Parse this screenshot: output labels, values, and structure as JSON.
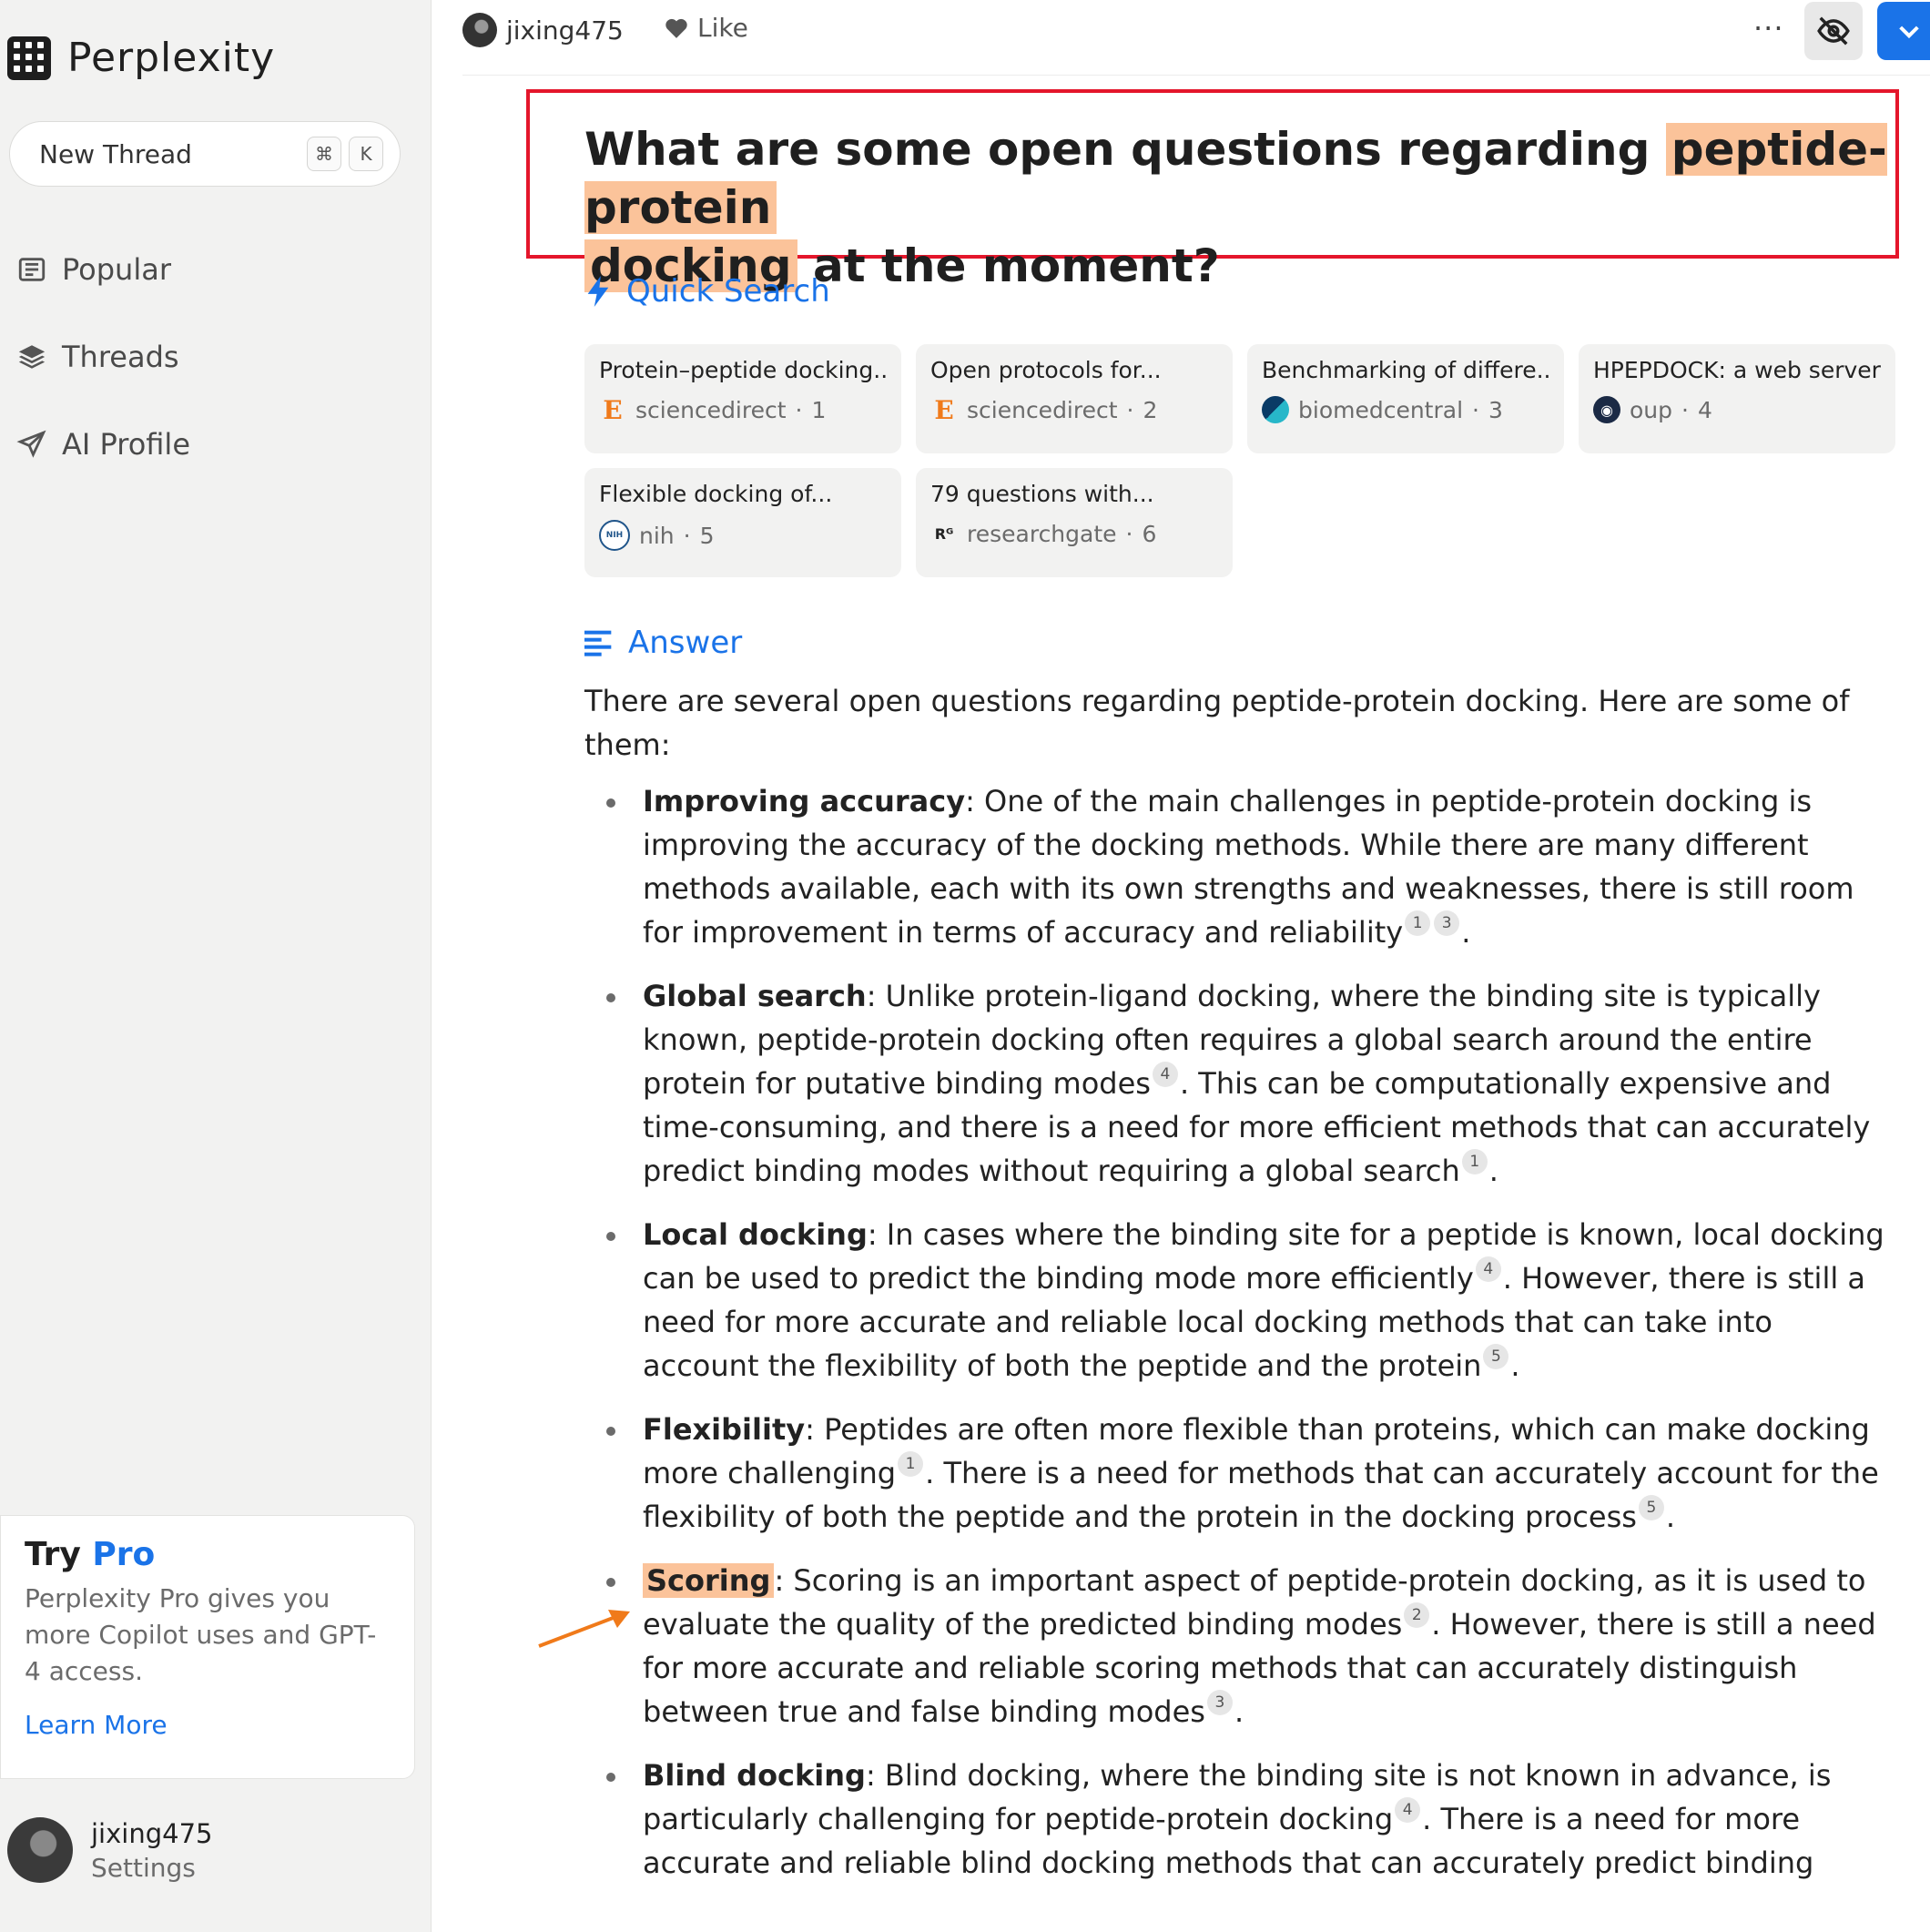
{
  "sidebar": {
    "brand": "Perplexity",
    "new_thread": "New Thread",
    "shortcut_cmd": "⌘",
    "shortcut_key": "K",
    "nav": [
      "Popular",
      "Threads",
      "AI Profile"
    ],
    "pro_try": "Try",
    "pro_word": "Pro",
    "pro_desc": "Perplexity Pro gives you more Copilot uses and GPT-4 access.",
    "pro_link": "Learn More",
    "user_name": "jixing475",
    "user_settings": "Settings"
  },
  "topbar": {
    "user": "jixing475",
    "like": "Like",
    "more": "···"
  },
  "question": {
    "part1": "What are some open questions regarding ",
    "highlight1": "peptide-protein",
    "highlight2": "docking",
    "part2": " at the moment?"
  },
  "quick_search_label": "Quick Search",
  "sources": [
    {
      "title": "Protein–peptide docking...",
      "site": "sciencedirect",
      "num": "1",
      "icon": "elsevier-icon"
    },
    {
      "title": "Open protocols for...",
      "site": "sciencedirect",
      "num": "2",
      "icon": "elsevier-icon"
    },
    {
      "title": "Benchmarking of differe...",
      "site": "biomedcentral",
      "num": "3",
      "icon": "bmc-icon"
    },
    {
      "title": "HPEPDOCK: a web server...",
      "site": "oup",
      "num": "4",
      "icon": "oup-icon"
    },
    {
      "title": "Flexible docking of...",
      "site": "nih",
      "num": "5",
      "icon": "nih-icon"
    },
    {
      "title": "79 questions with...",
      "site": "researchgate",
      "num": "6",
      "icon": "researchgate-icon"
    }
  ],
  "answer_label": "Answer",
  "answer_intro": "There are several open questions regarding peptide-protein docking. Here are some of them:",
  "bullets": [
    {
      "term": "Improving accuracy",
      "segments": [
        {
          "text": ": One of the main challenges in peptide-protein docking is improving the accuracy of the docking methods. While there are many different methods available, each with its own strengths and weaknesses, there is still room for improvement in terms of accuracy and reliability",
          "cites": [
            "1",
            "3"
          ]
        },
        {
          "text": ".",
          "cites": []
        }
      ]
    },
    {
      "term": "Global search",
      "segments": [
        {
          "text": ": Unlike protein-ligand docking, where the binding site is typically known, peptide-protein docking often requires a global search around the entire protein for putative binding modes",
          "cites": [
            "4"
          ]
        },
        {
          "text": ". This can be computationally expensive and time-consuming, and there is a need for more efficient methods that can accurately predict binding modes without requiring a global search",
          "cites": [
            "1"
          ]
        },
        {
          "text": ".",
          "cites": []
        }
      ]
    },
    {
      "term": "Local docking",
      "segments": [
        {
          "text": ": In cases where the binding site for a peptide is known, local docking can be used to predict the binding mode more efficiently",
          "cites": [
            "4"
          ]
        },
        {
          "text": ". However, there is still a need for more accurate and reliable local docking methods that can take into account the flexibility of both the peptide and the protein",
          "cites": [
            "5"
          ]
        },
        {
          "text": ".",
          "cites": []
        }
      ]
    },
    {
      "term": "Flexibility",
      "segments": [
        {
          "text": ": Peptides are often more flexible than proteins, which can make docking more challenging",
          "cites": [
            "1"
          ]
        },
        {
          "text": ". There is a need for methods that can accurately account for the flexibility of both the peptide and the protein in the docking process",
          "cites": [
            "5"
          ]
        },
        {
          "text": ".",
          "cites": []
        }
      ]
    },
    {
      "term": "Scoring",
      "highlight": true,
      "segments": [
        {
          "text": ": Scoring is an important aspect of peptide-protein docking, as it is used to evaluate the quality of the predicted binding modes",
          "cites": [
            "2"
          ]
        },
        {
          "text": ". However, there is still a need for more accurate and reliable scoring methods that can accurately distinguish between true and false binding modes",
          "cites": [
            "3"
          ]
        },
        {
          "text": ".",
          "cites": []
        }
      ]
    },
    {
      "term": "Blind docking",
      "segments": [
        {
          "text": ": Blind docking, where the binding site is not known in advance, is particularly challenging for peptide-protein docking",
          "cites": [
            "4"
          ]
        },
        {
          "text": ". There is a need for more accurate and reliable blind docking methods that can accurately predict binding",
          "cites": []
        }
      ]
    }
  ],
  "colors": {
    "accent": "#1a73e8",
    "highlight": "#fbc39a",
    "annotation_box": "#e4162b",
    "arrow": "#f07a1a"
  }
}
